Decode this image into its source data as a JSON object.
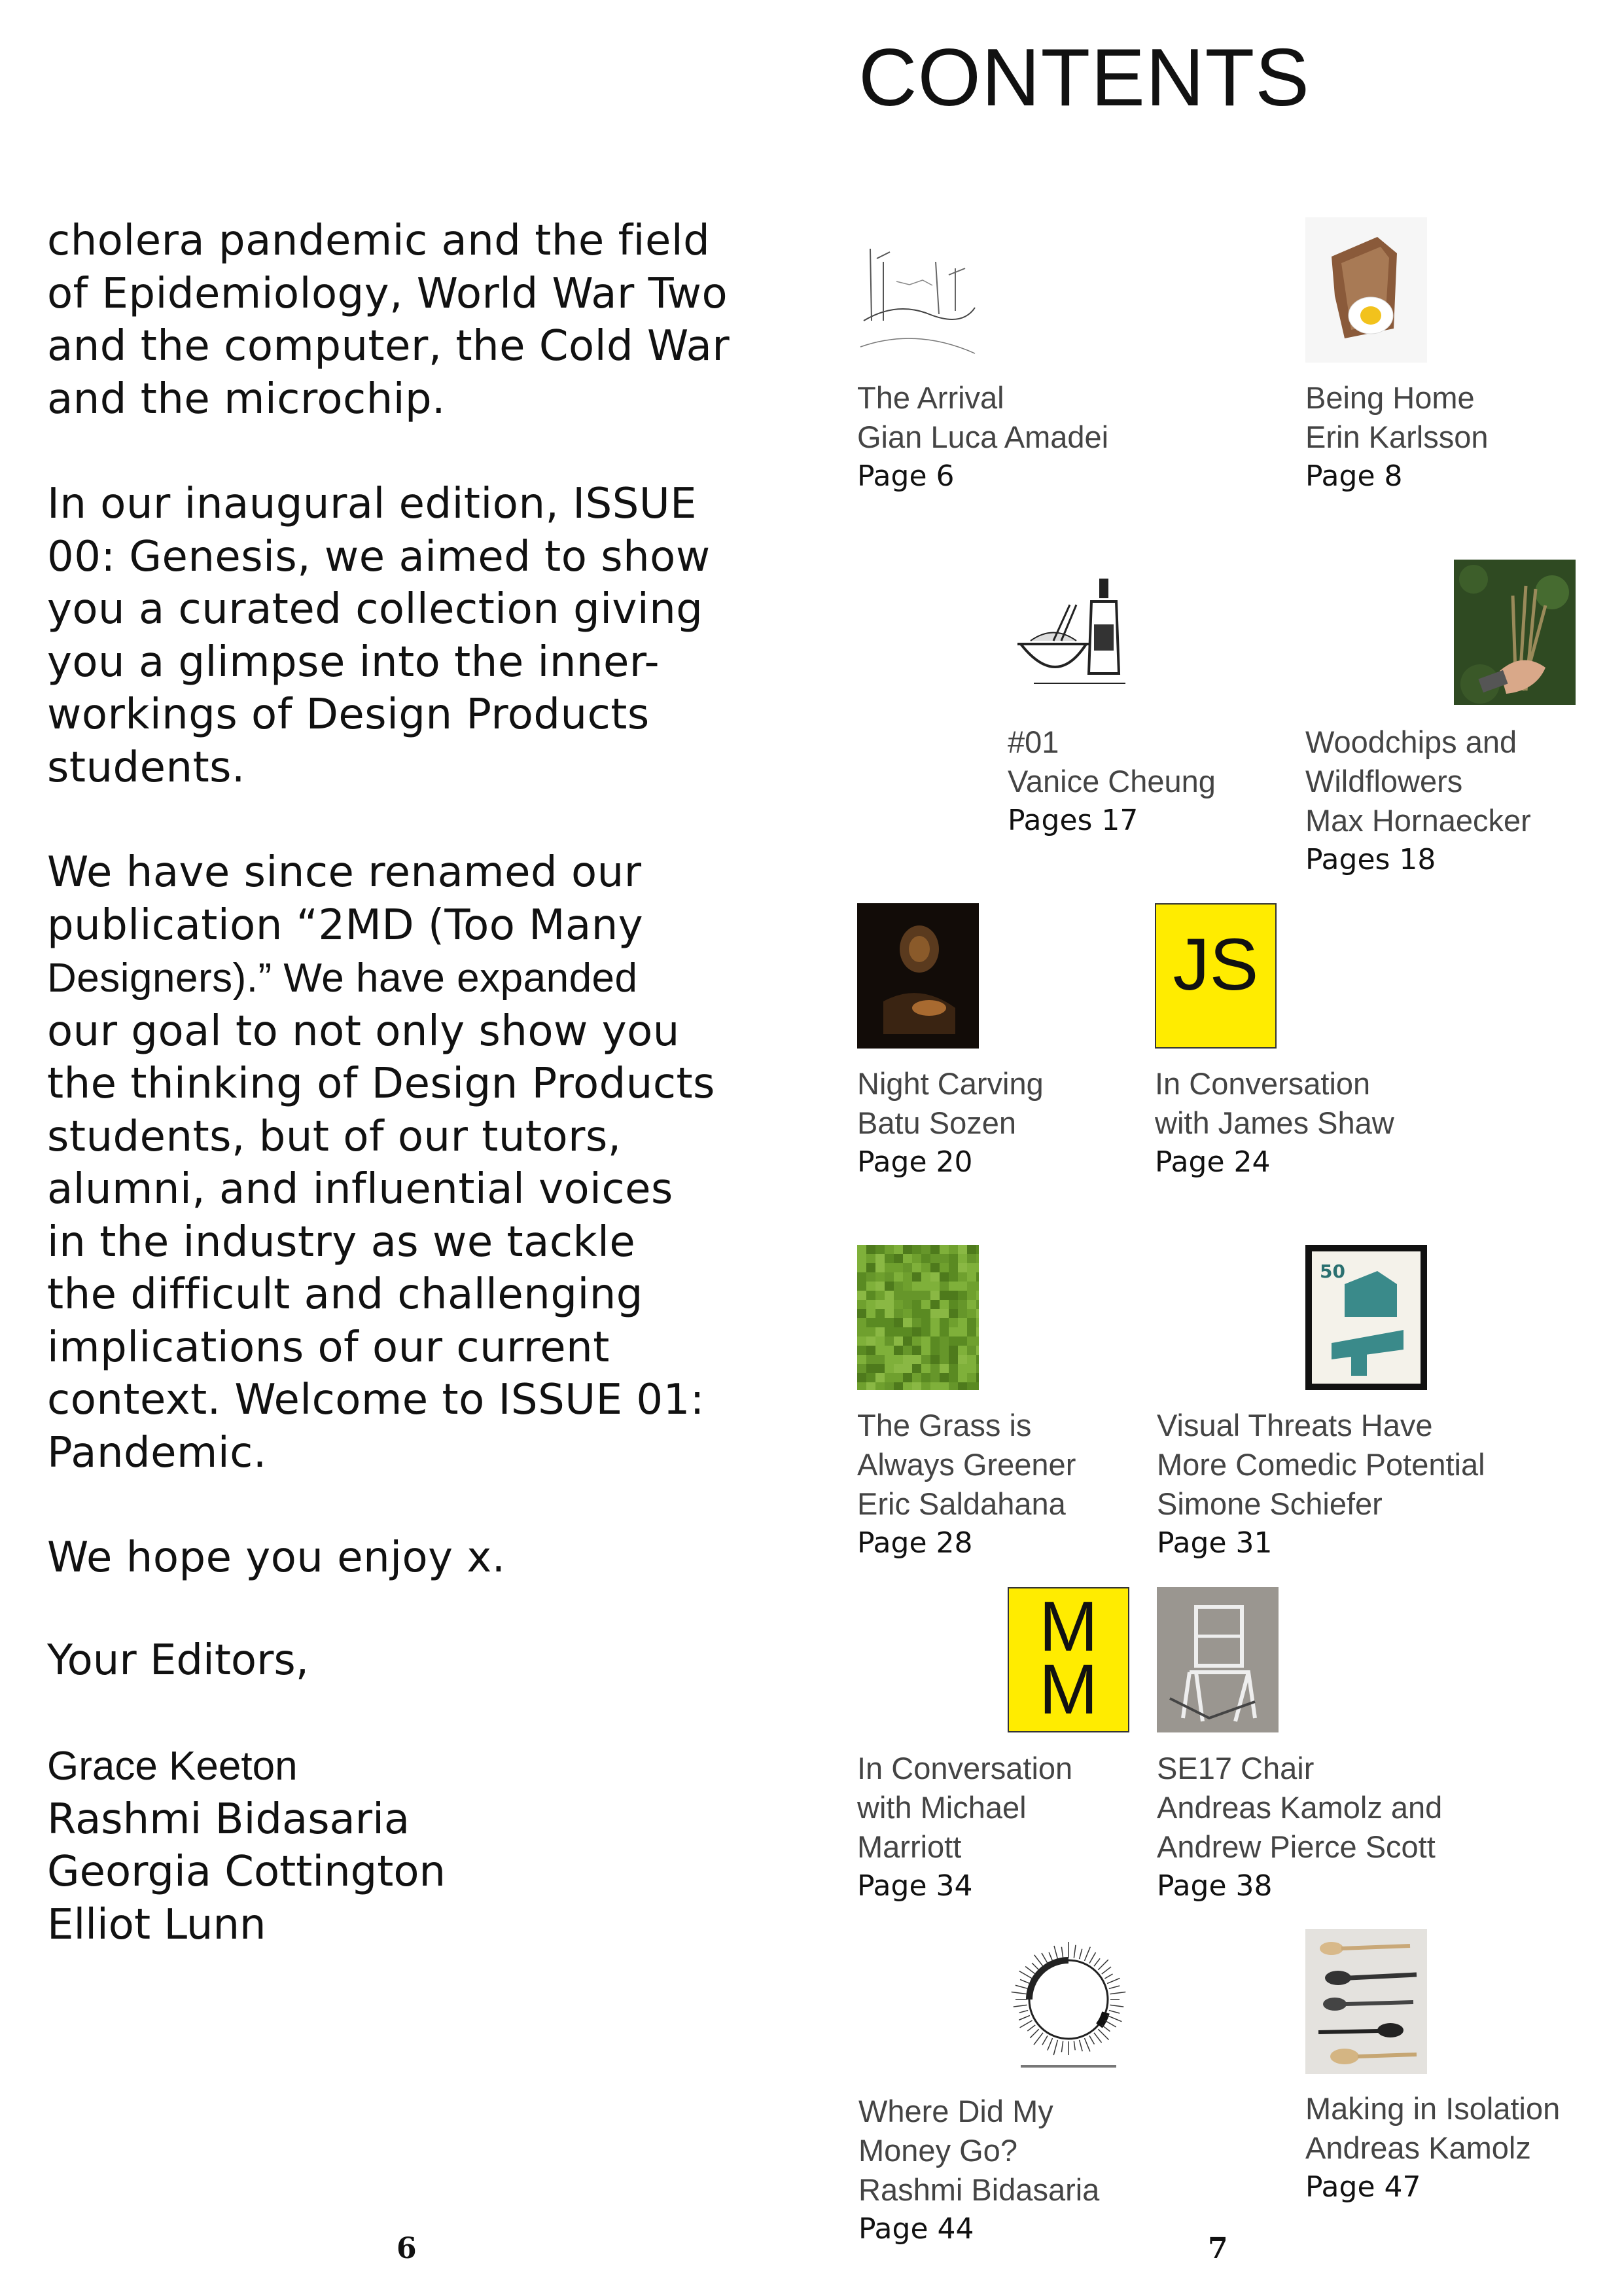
{
  "left": {
    "paragraphs": [
      [
        "cholera pandemic and the field",
        "of Epidemiology, World War Two",
        "and the computer, the Cold War",
        "and the microchip."
      ],
      [
        "In our inaugural edition, ISSUE",
        "00: Genesis, we aimed to show",
        "you a curated collection giving",
        "you a glimpse into the inner-",
        "workings of Design Products",
        "students."
      ],
      [
        "We have since renamed our",
        "publication “2MD (Too Many",
        "Designers).” We have expanded",
        "our goal to not only show you",
        "the thinking of Design Products",
        "students, but of our tutors,",
        "alumni, and influential voices",
        "in the industry as we tackle",
        "the difficult and challenging",
        "implications of our current",
        "context. Welcome to ISSUE 01:",
        "Pandemic."
      ],
      [
        "We hope you enjoy x."
      ]
    ],
    "editors_label": "Your Editors,",
    "editors": [
      "Grace Keeton",
      "Rashmi Bidasaria",
      "Georgia Cottington",
      "Elliot Lunn"
    ]
  },
  "title": "CONTENTS",
  "entries": [
    {
      "lines": [
        "The Arrival",
        "Gian Luca Amadei"
      ],
      "page": "Page 6",
      "thumb": "sketch-landscape-icon"
    },
    {
      "lines": [
        "Being Home",
        "Erin Karlsson"
      ],
      "page": "Page 8",
      "thumb": "toast-egg-icon"
    },
    {
      "lines": [
        "#01",
        "Vanice Cheung"
      ],
      "page": "Pages 17",
      "thumb": "bowl-bottle-icon"
    },
    {
      "lines": [
        "Woodchips and",
        "Wildflowers",
        "Max Hornaecker"
      ],
      "page": "Pages 18",
      "thumb": "hand-wildflowers-icon"
    },
    {
      "lines": [
        "Night Carving",
        "Batu Sozen"
      ],
      "page": "Page 20",
      "thumb": "night-carving-icon"
    },
    {
      "lines": [
        "In Conversation",
        "with James Shaw"
      ],
      "page": "Page 24",
      "thumb": "js-initials-icon",
      "initials": "JS"
    },
    {
      "lines": [
        "The Grass is",
        "Always Greener",
        "Eric Saldahana"
      ],
      "page": "Page 28",
      "thumb": "grass-pixel-icon"
    },
    {
      "lines": [
        "Visual Threats Have",
        "More Comedic Potential",
        "Simone Schiefer"
      ],
      "page": "Page 31",
      "thumb": "stamp-icon",
      "stamp_value": "50"
    },
    {
      "lines": [
        "In Conversation",
        "with Michael",
        "Marriott"
      ],
      "page": "Page 34",
      "thumb": "mm-initials-icon",
      "initials": "M\nM"
    },
    {
      "lines": [
        "SE17 Chair",
        "Andreas Kamolz and",
        "Andrew Pierce Scott"
      ],
      "page": "Page 38",
      "thumb": "chair-icon"
    },
    {
      "lines": [
        "Where Did My",
        "Money Go?",
        "Rashmi Bidasaria"
      ],
      "page": "Page 44",
      "thumb": "radial-clock-icon"
    },
    {
      "lines": [
        "Making in Isolation",
        "Andreas Kamolz"
      ],
      "page": "Page 47",
      "thumb": "spoons-icon"
    }
  ],
  "colors": {
    "accent_yellow": "#ffec00",
    "text": "#111111"
  },
  "page_numbers": {
    "left": "6",
    "right": "7"
  }
}
